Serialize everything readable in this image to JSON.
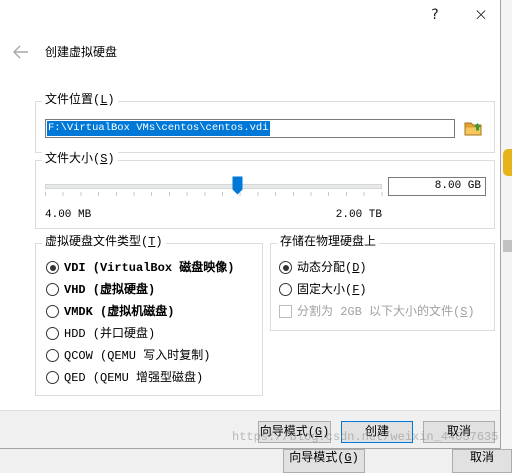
{
  "window": {
    "help_label": "?",
    "close_label": "×"
  },
  "header": {
    "back_icon": "back-arrow-icon",
    "title": "创建虚拟硬盘"
  },
  "file_location": {
    "title": "文件位置(L)",
    "path": "F:\\VirtualBox VMs\\centos\\centos.vdi",
    "path_selected": true,
    "browse_icon": "folder-icon"
  },
  "file_size": {
    "title": "文件大小(S)",
    "value": "8.00 GB",
    "min_label": "4.00 MB",
    "max_label": "2.00 TB",
    "slider_fraction": 0.57
  },
  "disk_type": {
    "title": "虚拟硬盘文件类型(T)",
    "options": [
      {
        "label": "VDI (VirtualBox 磁盘映像)",
        "selected": true
      },
      {
        "label": "VHD (虚拟硬盘)",
        "selected": false
      },
      {
        "label": "VMDK (虚拟机磁盘)",
        "selected": false
      },
      {
        "label": "HDD (并口硬盘)",
        "selected": false
      },
      {
        "label": "QCOW (QEMU 写入时复制)",
        "selected": false
      },
      {
        "label": "QED (QEMU 增强型磁盘)",
        "selected": false
      }
    ]
  },
  "storage": {
    "title": "存储在物理硬盘上",
    "options": [
      {
        "label": "动态分配(D)",
        "selected": true
      },
      {
        "label": "固定大小(F)",
        "selected": false
      }
    ],
    "split": {
      "label": "分割为 2GB 以下大小的文件(S)",
      "checked": false,
      "enabled": false
    }
  },
  "buttons": {
    "expert_mode": "向导模式(G)",
    "create": "创建",
    "cancel": "取消"
  },
  "background_window": {
    "buttons": [
      "向导模式(G)",
      "取消"
    ]
  },
  "watermark": "https://blog.csdn.net/weixin_44037635",
  "colors": {
    "accent": "#0078d7"
  }
}
